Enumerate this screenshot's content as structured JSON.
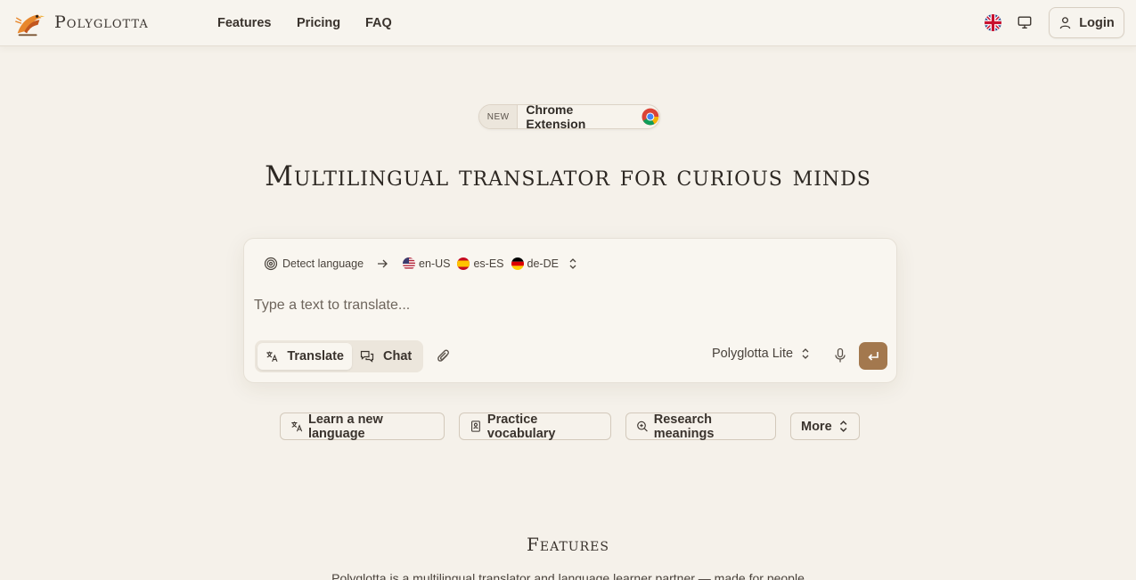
{
  "header": {
    "brand": "Polyglotta",
    "nav": [
      "Features",
      "Pricing",
      "FAQ"
    ],
    "login_label": "Login",
    "icons": [
      "bird-logo-icon",
      "uk-flag-icon",
      "monitor-icon",
      "user-icon"
    ]
  },
  "badge": {
    "tag": "NEW",
    "label": "Chrome Extension",
    "icon": "chrome-icon"
  },
  "hero": {
    "title": "Multilingual translator for curious minds"
  },
  "translator": {
    "source_language": "Detect language",
    "targets": [
      {
        "code": "en-US",
        "flag": "us-flag-icon"
      },
      {
        "code": "es-ES",
        "flag": "es-flag-icon"
      },
      {
        "code": "de-DE",
        "flag": "de-flag-icon"
      }
    ],
    "input_placeholder": "Type a text to translate...",
    "input_value": "",
    "modes": [
      "Translate",
      "Chat"
    ],
    "active_mode": "Translate",
    "model": "Polyglotta Lite",
    "send_color": "#a3784e"
  },
  "suggestions": [
    {
      "label": "Learn a new language",
      "icon": "translate-icon"
    },
    {
      "label": "Practice vocabulary",
      "icon": "notebook-icon"
    },
    {
      "label": "Research meanings",
      "icon": "search-icon"
    },
    {
      "label": "More",
      "icon": "chevron-updown-icon"
    }
  ],
  "features": {
    "title": "Features",
    "description": "Polyglotta is a multilingual translator and language learner partner — made for people"
  },
  "colors": {
    "background": "#f5f1ea",
    "accent": "#a3784e",
    "text": "#2d2824"
  }
}
